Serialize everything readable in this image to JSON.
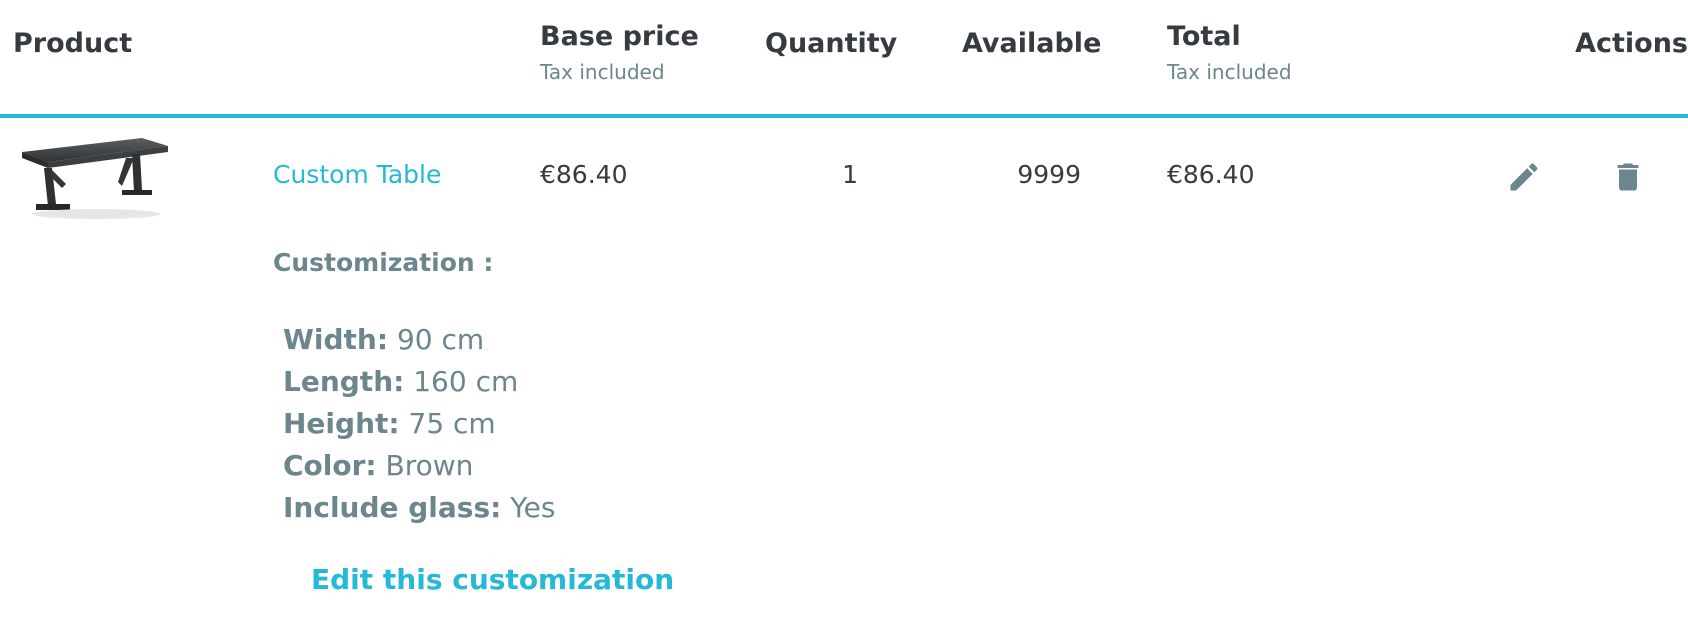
{
  "table": {
    "headers": {
      "product": "Product",
      "base_price": "Base price",
      "base_price_sub": "Tax included",
      "quantity": "Quantity",
      "available": "Available",
      "total": "Total",
      "total_sub": "Tax included",
      "actions": "Actions"
    },
    "row": {
      "product_name": "Custom Table",
      "base_price": "€86.40",
      "quantity": "1",
      "available": "9999",
      "total": "€86.40",
      "edit_icon": "pencil-icon",
      "delete_icon": "trash-icon"
    }
  },
  "customization": {
    "title": "Customization :",
    "items": [
      {
        "label": "Width:",
        "value": "90 cm"
      },
      {
        "label": "Length:",
        "value": "160 cm"
      },
      {
        "label": "Height:",
        "value": "75 cm"
      },
      {
        "label": "Color:",
        "value": "Brown"
      },
      {
        "label": "Include glass:",
        "value": "Yes"
      }
    ],
    "edit_link": "Edit this customization"
  },
  "colors": {
    "accent": "#25b9d7",
    "text_dark": "#363a41",
    "text_muted": "#6c868e"
  }
}
